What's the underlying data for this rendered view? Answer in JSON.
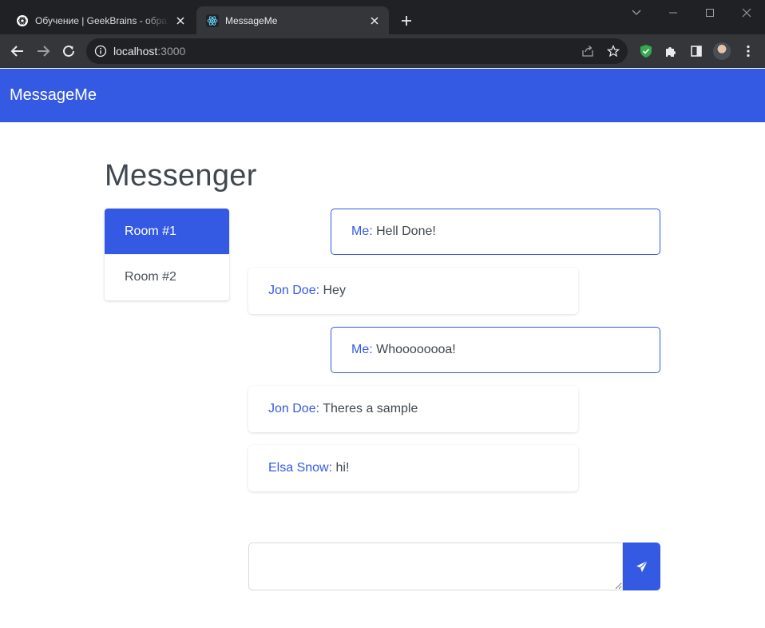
{
  "browser": {
    "tabs": [
      {
        "title": "Обучение | GeekBrains - образовательный портал",
        "favicon": "openai-icon",
        "active": false
      },
      {
        "title": "MessageMe",
        "favicon": "react-icon",
        "active": true
      }
    ],
    "url_host": "localhost",
    "url_port": ":3000"
  },
  "app": {
    "brand": "MessageMe",
    "page_title": "Messenger",
    "accent_color": "#345ae3",
    "rooms": [
      {
        "label": "Room #1",
        "active": true
      },
      {
        "label": "Room #2",
        "active": false
      }
    ],
    "messages": [
      {
        "author": "Me:",
        "text": " Hell Done!",
        "mine": true
      },
      {
        "author": "Jon Doe:",
        "text": " Hey",
        "mine": false
      },
      {
        "author": "Me:",
        "text": " Whoooooooa!",
        "mine": true
      },
      {
        "author": "Jon Doe:",
        "text": " Theres a sample",
        "mine": false
      },
      {
        "author": "Elsa Snow:",
        "text": " hi!",
        "mine": false
      }
    ],
    "composer": {
      "value": "",
      "placeholder": "",
      "send_icon": "send-icon"
    }
  }
}
